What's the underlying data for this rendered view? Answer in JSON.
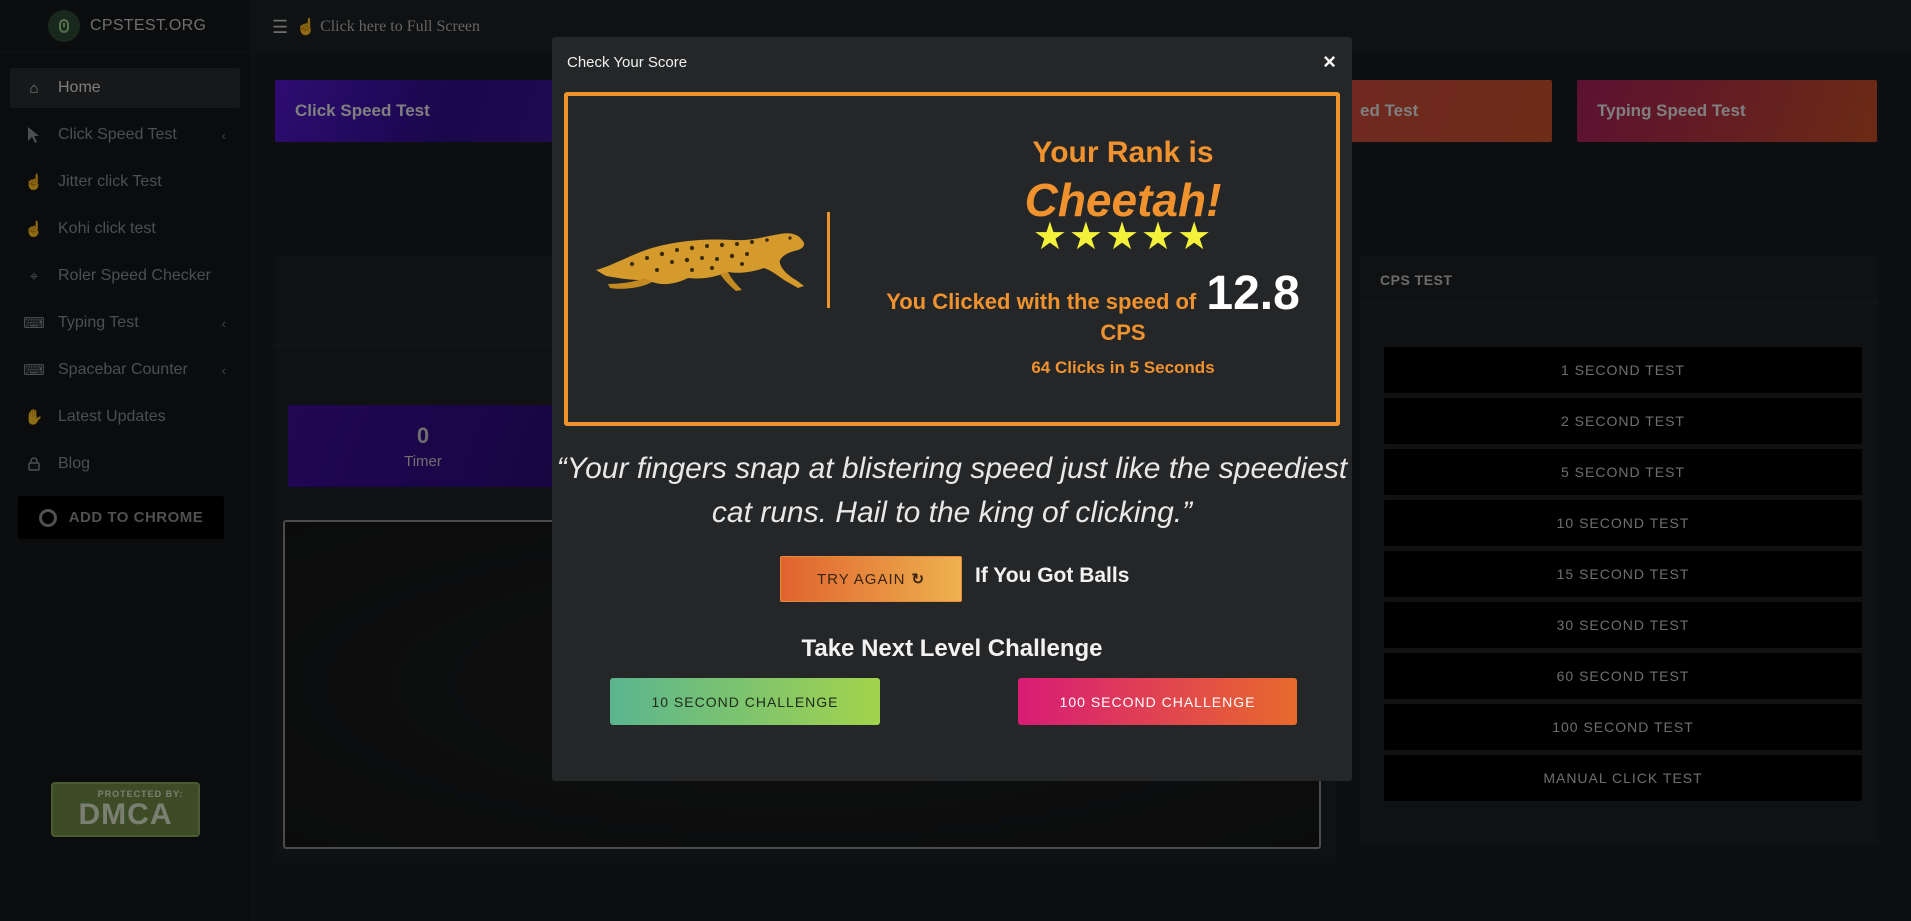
{
  "brand": {
    "name": "CPSTEST.ORG",
    "icon": "mouse-icon"
  },
  "sidebar": {
    "items": [
      {
        "label": "Home",
        "icon": "home-icon"
      },
      {
        "label": "Click Speed Test",
        "icon": "cursor-icon",
        "has_submenu": true
      },
      {
        "label": "Jitter click Test",
        "icon": "hand-pointer-icon"
      },
      {
        "label": "Kohi click test",
        "icon": "hand-pointer-icon"
      },
      {
        "label": "Roler Speed Checker",
        "icon": "crosshair-icon"
      },
      {
        "label": "Typing Test",
        "icon": "keyboard-icon",
        "has_submenu": true
      },
      {
        "label": "Spacebar Counter",
        "icon": "keyboard-icon",
        "has_submenu": true
      },
      {
        "label": "Latest Updates",
        "icon": "hand-icon"
      },
      {
        "label": "Blog",
        "icon": "lock-icon"
      }
    ],
    "chrome_button": "ADD TO CHROME",
    "dmca": {
      "top": "PROTECTED BY:",
      "main": "DMCA"
    }
  },
  "topbar": {
    "fullscreen_label": "Click here to Full Screen"
  },
  "tiles": {
    "click_speed": "Click Speed Test",
    "speed_partial": "ed Test",
    "typing_speed": "Typing Speed Test"
  },
  "timer": {
    "value": "0",
    "label": "Timer"
  },
  "cps_panel": {
    "title": "CPS TEST",
    "buttons": [
      "1 SECOND TEST",
      "2 SECOND TEST",
      "5 SECOND TEST",
      "10 SECOND TEST",
      "15 SECOND TEST",
      "30 SECOND TEST",
      "60 SECOND TEST",
      "100 SECOND TEST",
      "MANUAL CLICK TEST"
    ]
  },
  "modal": {
    "title": "Check Your Score",
    "close": "×",
    "rank_label": "Your Rank is",
    "rank_name": "Cheetah!",
    "stars": "★★★★★",
    "star_count": 5,
    "speed_prefix": "You Clicked with the speed of",
    "speed_value": "12.8",
    "unit": "CPS",
    "clicks_summary": "64 Clicks in 5 Seconds",
    "quote_line1": "“Your fingers snap at blistering speed just like the speediest",
    "quote_line2": "cat runs. Hail to the king of clicking.”",
    "try_again": "TRY AGAIN",
    "try_again_icon": "↻",
    "balls_text": "If You Got Balls",
    "next_title": "Take Next Level Challenge",
    "challenge_10": "10 SECOND CHALLENGE",
    "challenge_100": "100 SECOND CHALLENGE"
  },
  "colors": {
    "accent_orange": "#f0922e",
    "star_yellow": "#f4f13a",
    "sidebar_bg": "#141618",
    "modal_bg": "#242628"
  }
}
